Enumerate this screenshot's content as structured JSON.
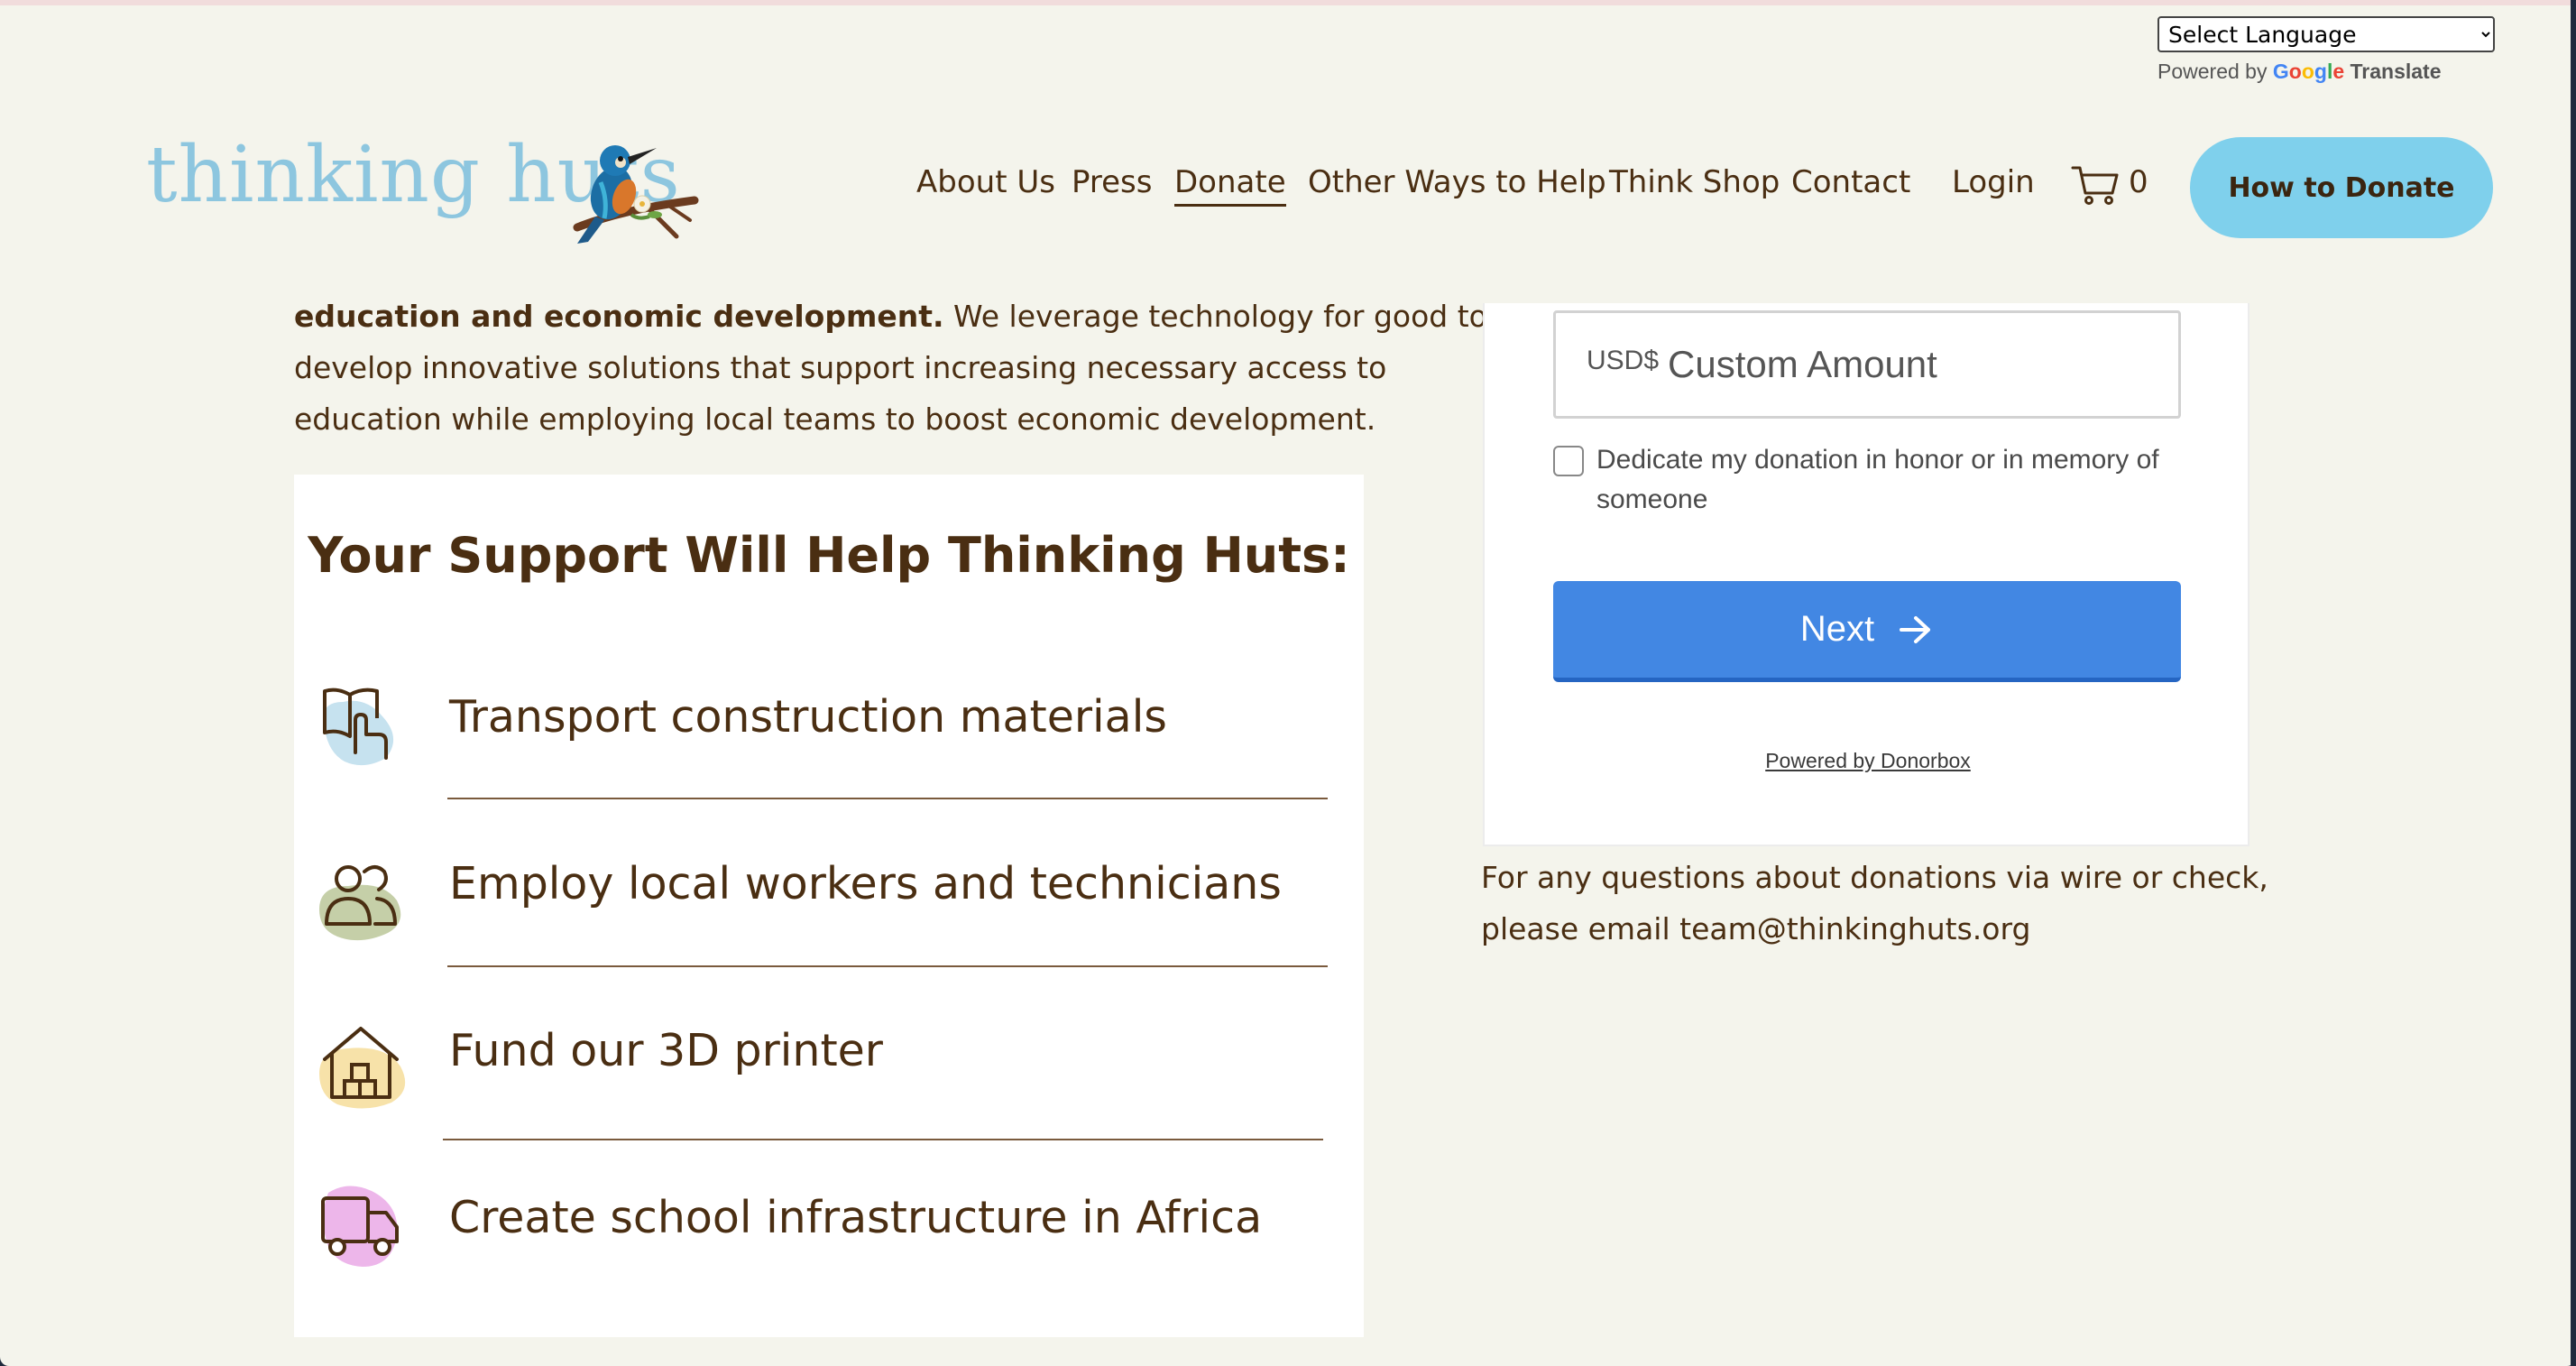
{
  "translate": {
    "select_label": "Select Language",
    "powered_by": "Powered by",
    "google": "Google",
    "translate_word": "Translate"
  },
  "header": {
    "logo_text": "thinking huts",
    "nav": [
      {
        "label": "About Us"
      },
      {
        "label": "Press"
      },
      {
        "label": "Donate",
        "active": true
      },
      {
        "label": "Other Ways to Help"
      },
      {
        "label": "Think Shop"
      },
      {
        "label": "Contact"
      },
      {
        "label": "Login"
      }
    ],
    "cart_count": "0",
    "cta_label": "How to Donate",
    "colors": {
      "logo": "#8dc6df",
      "cta": "#7fd0ec",
      "text": "#4a2e12"
    }
  },
  "intro": {
    "bold_text": "education and economic development.",
    "line1_rest": " We leverage technology for good to",
    "line2": "develop innovative solutions that support increasing necessary access to",
    "line3": "education while employing local teams to boost economic development."
  },
  "support": {
    "title": "Your Support Will Help Thinking Huts:",
    "items": [
      {
        "icon": "book-hand-icon",
        "text": "Transport construction materials"
      },
      {
        "icon": "people-icon",
        "text": "Employ local workers and technicians"
      },
      {
        "icon": "house-bricks-icon",
        "text": "Fund our 3D printer"
      },
      {
        "icon": "truck-icon",
        "text": "Create school infrastructure in Africa"
      }
    ]
  },
  "donation_form": {
    "currency": "USD$",
    "amount_placeholder": "Custom Amount",
    "dedicate_label": "Dedicate my donation in honor or in memory of someone",
    "next_label": "Next",
    "powered_by": "Powered by Donorbox",
    "button_color": "#4287e3"
  },
  "questions": {
    "line1": "For any questions about donations via wire or check,",
    "line2": "please email team@thinkinghuts.org"
  }
}
